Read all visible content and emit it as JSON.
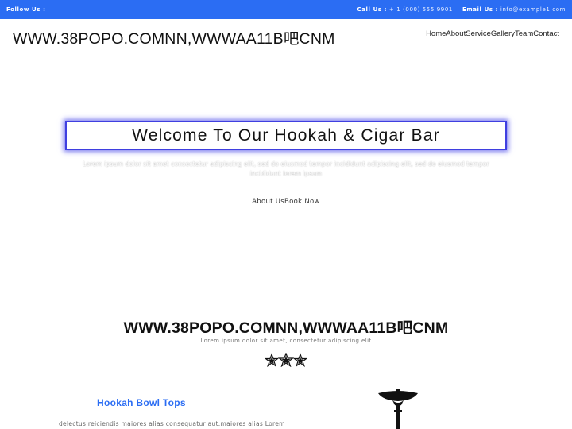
{
  "topbar": {
    "follow_label": "Follow Us :",
    "call_label": "Call Us :",
    "call_value": "+ 1 (000) 555 9901",
    "email_label": "Email Us :",
    "email_value": "info@example1.com"
  },
  "header": {
    "brand": "WWW.38POPO.COMNN,WWWAA11B吧CNM",
    "nav": [
      "Home",
      "About",
      "Service",
      "Gallery",
      "Team",
      "Contact"
    ]
  },
  "hero": {
    "title": "Welcome To Our Hookah & Cigar Bar",
    "lorem": "Lorem ipsum dolor sit amet consectetur adipiscing elit, sed do eiusmod tempor incididunt adipiscing elit, sed do eiusmod tempor incididunt lorem ipsum",
    "about_link": "About Us",
    "book_link": "Book Now"
  },
  "section": {
    "title": "WWW.38POPO.COMNN,WWWAA11B吧CNM",
    "subtitle": "Lorem ipsum dolor sit amet, consectetur adipiscing elit",
    "divider_icon": "three-stars-icon"
  },
  "card": {
    "title": "Hookah Bowl Tops",
    "text": "delectus reiciendis maiores alias consequatur aut.maiores alias Lorem",
    "image_icon": "hookah-icon"
  },
  "colors": {
    "accent": "#2b6df3",
    "box_border": "#3f3fe0"
  }
}
